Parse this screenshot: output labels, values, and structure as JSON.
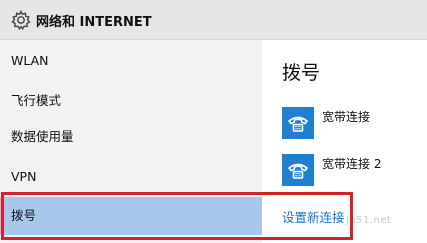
{
  "header": {
    "title": "网络和 INTERNET",
    "icon": "gear-icon"
  },
  "sidebar": {
    "items": [
      {
        "label": "WLAN"
      },
      {
        "label": "飞行模式"
      },
      {
        "label": "数据使用量"
      },
      {
        "label": "VPN"
      },
      {
        "label": "拨号",
        "selected": true
      }
    ],
    "selected_color": "#a7c8ea"
  },
  "main": {
    "title": "拨号",
    "connections": [
      {
        "label": "宽带连接",
        "icon": "dialup-phone-icon"
      },
      {
        "label": "宽带连接 2",
        "icon": "dialup-phone-icon"
      }
    ],
    "setup_link": "设置新连接",
    "accent_color": "#1f7fd0"
  },
  "watermark": "jb51.net",
  "annotation": {
    "highlight_color": "#d2232a"
  }
}
